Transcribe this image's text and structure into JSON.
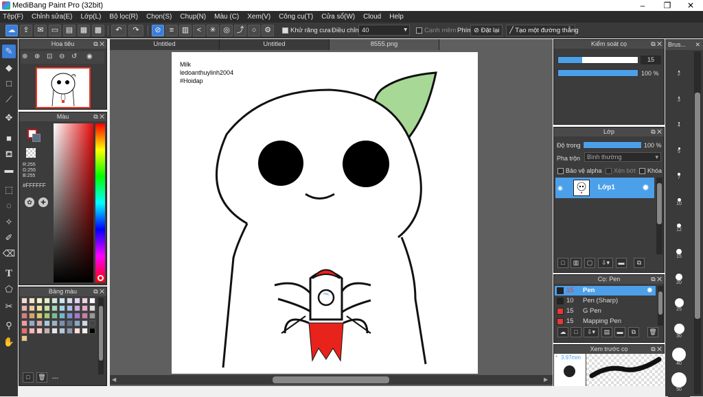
{
  "window": {
    "title": "MediBang Paint Pro (32bit)"
  },
  "menu": [
    "Tệp(F)",
    "Chỉnh sửa(E)",
    "Lớp(L)",
    "Bộ lọc(R)",
    "Chọn(S)",
    "Chụp(N)",
    "Màu (C)",
    "Xem(V)",
    "Công cụ(T)",
    "Cửa sổ(W)",
    "Cloud",
    "Help"
  ],
  "toolbar": {
    "antialias_label": "Khử răng cưa",
    "correction_label": "Điều chỉnh",
    "correction_value": "40",
    "snap_label": "Cạnh mềm",
    "key_label": "Phím",
    "reset_label": "Đặt lại",
    "new_straight_label": "Tạo một đường thẳng"
  },
  "navigator": {
    "title": "Hoa tiêu"
  },
  "color_panel": {
    "title": "Màu",
    "r": "R:255",
    "g": "G:255",
    "b": "B:255",
    "hex": "#FFFFFF"
  },
  "palette": {
    "title": "Bảng màu",
    "footer": "---"
  },
  "tabs": [
    "Untitled",
    "Untitled",
    "8555.png"
  ],
  "canvas_text": {
    "line1": "Milk",
    "line2": "ledoanthuylinh2004",
    "line3": "#Hoidap"
  },
  "brush_control": {
    "title": "Kiểm soát cọ",
    "size": "15",
    "opacity": "100 %",
    "size_fraction": 0.3,
    "opacity_fraction": 1.0
  },
  "layer_panel": {
    "title": "Lớp",
    "opacity_label": "Độ trong",
    "opacity_value": "100 %",
    "blend_label": "Pha trộn",
    "blend_value": "Bình thường",
    "protect_alpha": "Bảo vệ alpha",
    "clipping": "Xén bớt",
    "lock": "Khóa",
    "layer_name": "Lớp1"
  },
  "brush_panel": {
    "title": "Cọ: Pen",
    "brushes": [
      {
        "size": "15",
        "name": "Pen",
        "color": "#222222",
        "selected": true
      },
      {
        "size": "10",
        "name": "Pen (Sharp)",
        "color": "#222222",
        "selected": false
      },
      {
        "size": "15",
        "name": "G Pen",
        "color": "#e53935",
        "selected": false
      },
      {
        "size": "15",
        "name": "Mapping Pen",
        "color": "#e53935",
        "selected": false
      }
    ]
  },
  "preview": {
    "title": "Xem trước cọ",
    "size": "3.97mm",
    "mark": "*"
  },
  "brush_strip": {
    "title": "Brus...",
    "sizes": [
      "2",
      "3",
      "4",
      "5",
      "7",
      "10",
      "12",
      "15",
      "20",
      "25",
      "30",
      "40",
      "50"
    ]
  },
  "colors": {
    "accent": "#3b7dd8",
    "primary_color": "#c8161d"
  }
}
